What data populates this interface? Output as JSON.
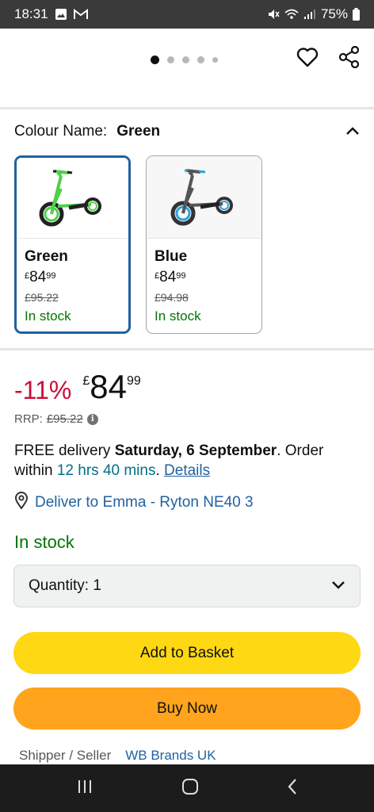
{
  "status_bar": {
    "time": "18:31",
    "battery": "75%",
    "icons": [
      "gallery-icon",
      "gmail-icon",
      "mute-icon",
      "wifi-icon",
      "signal-icon",
      "battery-icon"
    ]
  },
  "gallery": {
    "image_count": 5,
    "active_index": 0,
    "icons": [
      "heart-icon",
      "share-icon"
    ]
  },
  "colour": {
    "label": "Colour Name:",
    "selected": "Green",
    "options": [
      {
        "name": "Green",
        "currency": "£",
        "whole": "84",
        "fraction": "99",
        "was": "£95.22",
        "stock": "In stock",
        "frame_color": "#4fd04a",
        "wheel_color": "#222222"
      },
      {
        "name": "Blue",
        "currency": "£",
        "whole": "84",
        "fraction": "99",
        "was": "£94.98",
        "stock": "In stock",
        "frame_color": "#444444",
        "wheel_color": "#2aa3e0"
      }
    ]
  },
  "price": {
    "discount": "-11%",
    "currency": "£",
    "whole": "84",
    "fraction": "99",
    "rrp_label": "RRP:",
    "rrp_value": "£95.22"
  },
  "delivery": {
    "prefix": "FREE delivery",
    "date": "Saturday, 6 September",
    "order_text": ". Order within",
    "countdown": "12 hrs 40 mins",
    "sep": ".",
    "details": "Details"
  },
  "deliver_to": "Deliver to Emma - Ryton NE40 3",
  "stock_status": "In stock",
  "quantity": {
    "label": "Quantity:",
    "value": "1"
  },
  "buttons": {
    "add_to_basket": "Add to Basket",
    "buy_now": "Buy Now"
  },
  "seller": {
    "label": "Shipper / Seller",
    "name": "WB Brands UK"
  },
  "colors": {
    "discount_red": "#cc0c39",
    "stock_green": "#007600",
    "link_blue": "#2162a1",
    "basket_yellow": "#ffd814",
    "buy_orange": "#ffa41c"
  }
}
